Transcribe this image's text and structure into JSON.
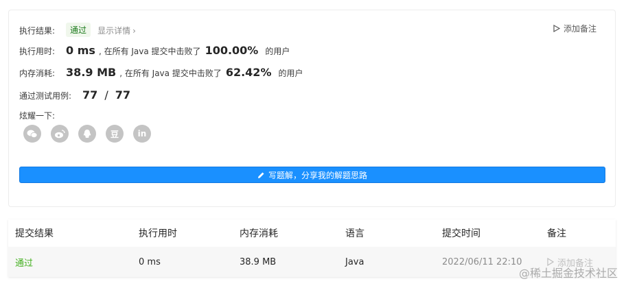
{
  "result": {
    "label": "执行结果:",
    "status": "通过",
    "details_link": "显示详情",
    "details_chevron": "›",
    "add_note": "添加备注"
  },
  "runtime": {
    "label": "执行用时:",
    "value": "0 ms",
    "prefix": ", 在所有 Java 提交中击败了",
    "percent": "100.00%",
    "suffix": "的用户"
  },
  "memory": {
    "label": "内存消耗:",
    "value": "38.9 MB",
    "prefix": ", 在所有 Java 提交中击败了",
    "percent": "62.42%",
    "suffix": "的用户"
  },
  "tests": {
    "label": "通过测试用例:",
    "passed": "77",
    "separator": "/",
    "total": "77"
  },
  "share": {
    "label": "炫耀一下:",
    "icons": [
      "wechat-icon",
      "weibo-icon",
      "qq-icon",
      "douban-icon",
      "linkedin-icon"
    ],
    "douban_glyph": "豆",
    "linkedin_glyph": "in"
  },
  "solution_button": "写题解，分享我的解题思路",
  "table": {
    "headers": [
      "提交结果",
      "执行用时",
      "内存消耗",
      "语言",
      "提交时间",
      "备注"
    ],
    "row": {
      "status": "通过",
      "runtime": "0 ms",
      "memory": "38.9 MB",
      "language": "Java",
      "time": "2022/06/11 22:10",
      "note": "添加备注"
    }
  },
  "watermark": "@稀土掘金技术社区",
  "colors": {
    "accent": "#1a90ff",
    "success": "#45b021",
    "icon_gray": "#c4c4c4"
  }
}
